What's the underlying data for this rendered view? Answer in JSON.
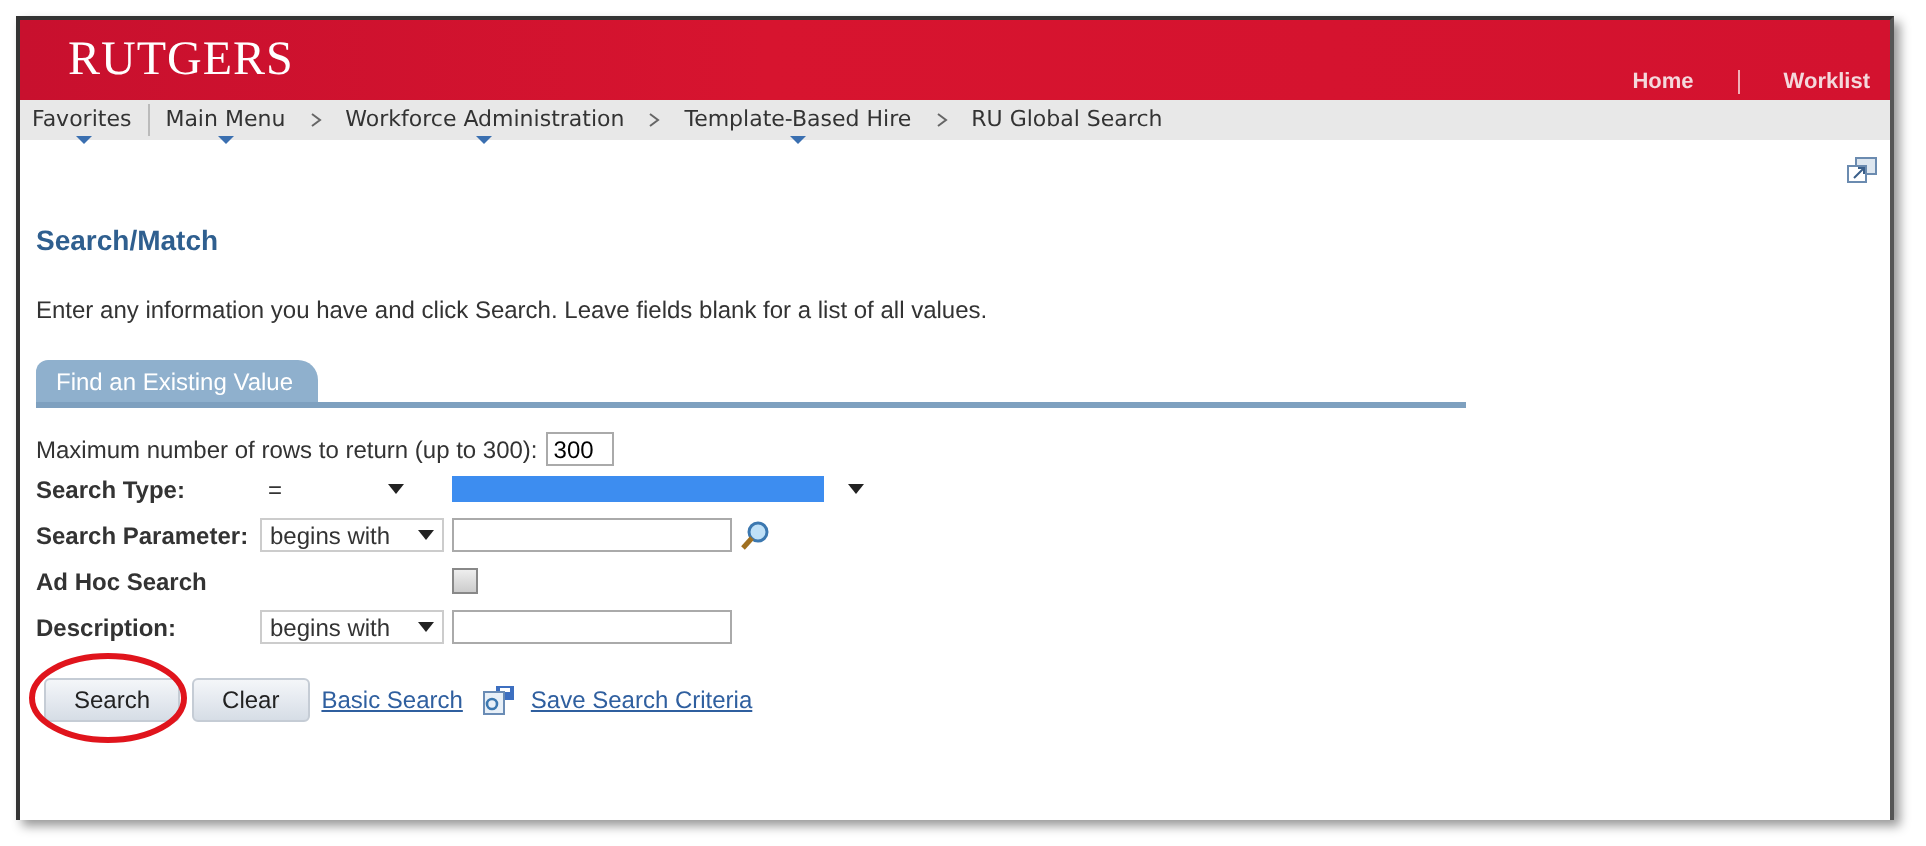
{
  "header": {
    "logo": "RUTGERS",
    "links": [
      "Home",
      "Worklist"
    ]
  },
  "nav": {
    "items": [
      {
        "label": "Favorites",
        "menu": true,
        "separator": false
      },
      {
        "label": "Main Menu",
        "menu": true,
        "separator": false
      },
      {
        "label": "Workforce Administration",
        "menu": true,
        "separator": true
      },
      {
        "label": "Template-Based Hire",
        "menu": true,
        "separator": true
      },
      {
        "label": "RU Global Search",
        "menu": false,
        "separator": true
      }
    ]
  },
  "page_title": "Search/Match",
  "instructions": "Enter any information you have and click Search. Leave fields blank for a list of all values.",
  "tabs": [
    {
      "label": "Find an Existing Value",
      "selected": true
    }
  ],
  "max_rows": {
    "label": "Maximum number of rows to return (up to 300):",
    "value": "300"
  },
  "fields": [
    {
      "kind": "select2",
      "label": "Search Type:",
      "operator": "=",
      "highlighted": true
    },
    {
      "kind": "lookup",
      "label": "Search Parameter:",
      "operator": "begins with"
    },
    {
      "kind": "checkbox",
      "label": "Ad Hoc Search",
      "checked": false
    },
    {
      "kind": "text",
      "label": "Description:",
      "operator": "begins with"
    }
  ],
  "buttons": [
    {
      "label": "Search",
      "circled": true
    },
    {
      "label": "Clear",
      "circled": false
    }
  ],
  "links": [
    "Basic Search",
    "Save Search Criteria"
  ]
}
